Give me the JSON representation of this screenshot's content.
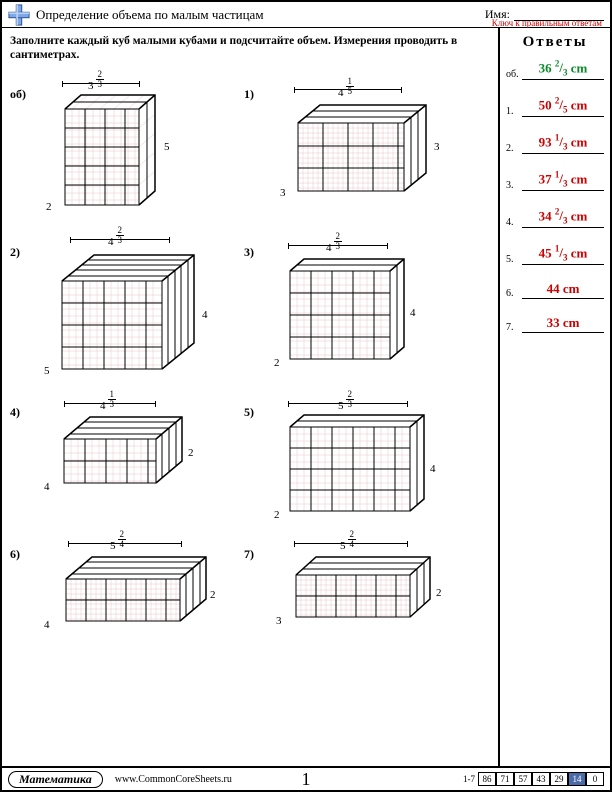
{
  "header": {
    "title": "Определение объема по малым частицам",
    "name_label": "Имя:",
    "key_label": "Ключ к правильным ответам"
  },
  "instructions": "Заполните каждый куб малыми кубами и подсчитайте объем. Измерения проводить в сантиметрах.",
  "answers_title": "Ответы",
  "problems": [
    {
      "n": "об)",
      "top_w": "3",
      "top_n": "2",
      "top_d": "3",
      "depth": "2",
      "height": "5"
    },
    {
      "n": "1)",
      "top_w": "4",
      "top_n": "1",
      "top_d": "5",
      "depth": "3",
      "height": "3"
    },
    {
      "n": "2)",
      "top_w": "4",
      "top_n": "2",
      "top_d": "3",
      "depth": "5",
      "height": "4"
    },
    {
      "n": "3)",
      "top_w": "4",
      "top_n": "2",
      "top_d": "3",
      "depth": "2",
      "height": "4"
    },
    {
      "n": "4)",
      "top_w": "4",
      "top_n": "1",
      "top_d": "3",
      "depth": "4",
      "height": "2"
    },
    {
      "n": "5)",
      "top_w": "5",
      "top_n": "2",
      "top_d": "3",
      "depth": "2",
      "height": "4"
    },
    {
      "n": "6)",
      "top_w": "5",
      "top_n": "2",
      "top_d": "4",
      "depth": "4",
      "height": "2"
    },
    {
      "n": "7)",
      "top_w": "5",
      "top_n": "2",
      "top_d": "4",
      "depth": "3",
      "height": "2"
    }
  ],
  "answers": [
    {
      "n": "об.",
      "val": "36",
      "fn": "2",
      "fd": "3",
      "unit": "cm",
      "color": "g"
    },
    {
      "n": "1.",
      "val": "50",
      "fn": "2",
      "fd": "5",
      "unit": "cm",
      "color": "r"
    },
    {
      "n": "2.",
      "val": "93",
      "fn": "1",
      "fd": "3",
      "unit": "cm",
      "color": "r"
    },
    {
      "n": "3.",
      "val": "37",
      "fn": "1",
      "fd": "3",
      "unit": "cm",
      "color": "r"
    },
    {
      "n": "4.",
      "val": "34",
      "fn": "2",
      "fd": "3",
      "unit": "cm",
      "color": "r"
    },
    {
      "n": "5.",
      "val": "45",
      "fn": "1",
      "fd": "3",
      "unit": "cm",
      "color": "r"
    },
    {
      "n": "6.",
      "val": "44",
      "fn": "",
      "fd": "",
      "unit": "cm",
      "color": "r"
    },
    {
      "n": "7.",
      "val": "33",
      "fn": "",
      "fd": "",
      "unit": "cm",
      "color": "r"
    }
  ],
  "footer": {
    "subject": "Математика",
    "site": "www.CommonCoreSheets.ru",
    "page": "1",
    "score_label": "1-7",
    "scores": [
      "86",
      "71",
      "57",
      "43",
      "29",
      "14",
      "0"
    ]
  }
}
